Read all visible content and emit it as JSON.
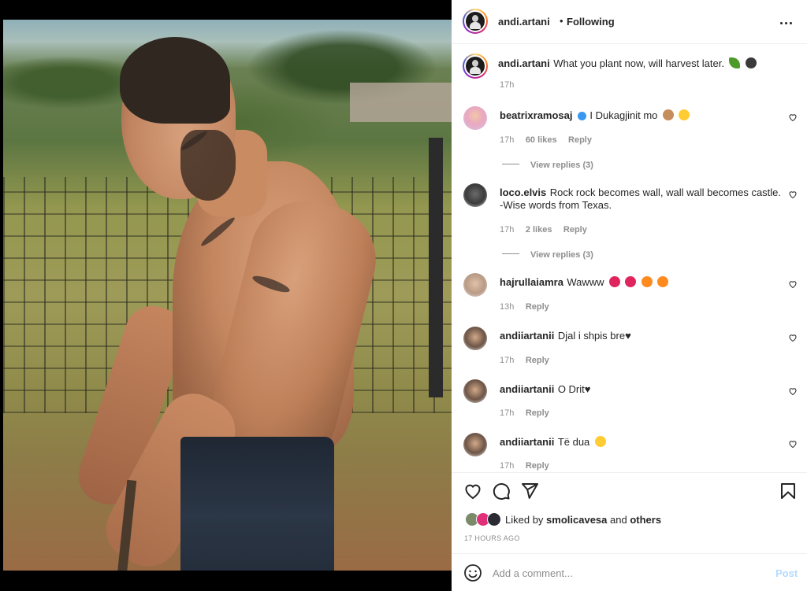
{
  "post": {
    "author": "andi.artani",
    "follow_status": "Following",
    "caption_text": "What you plant now, will harvest later.",
    "caption_time": "17h"
  },
  "comments": [
    {
      "user": "beatrixramosaj",
      "verified": true,
      "text": "I Dukagjinit mo",
      "time": "17h",
      "likes": "60 likes",
      "reply": "Reply",
      "view_replies": "View replies (3)"
    },
    {
      "user": "loco.elvis",
      "verified": false,
      "text": "Rock rock becomes wall, wall wall becomes castle.",
      "text2": "-Wise words from Texas.",
      "time": "17h",
      "likes": "2 likes",
      "reply": "Reply",
      "view_replies": "View replies (3)"
    },
    {
      "user": "hajrullaiamra",
      "verified": false,
      "text": "Wawww",
      "time": "13h",
      "reply": "Reply"
    },
    {
      "user": "andiiartanii",
      "verified": false,
      "text": "Djal i shpis bre",
      "time": "17h",
      "reply": "Reply"
    },
    {
      "user": "andiiartanii",
      "verified": false,
      "text": "O Drit",
      "time": "17h",
      "reply": "Reply"
    },
    {
      "user": "andiiartanii",
      "verified": false,
      "text": "Të dua",
      "time": "17h",
      "reply": "Reply"
    }
  ],
  "actions": {
    "liked_by_prefix": "Liked by",
    "liked_by_user": "smolicavesa",
    "liked_by_and": "and",
    "liked_by_others": "others",
    "timestamp": "17 HOURS AGO"
  },
  "composer": {
    "placeholder": "Add a comment...",
    "post_label": "Post"
  },
  "icons": {
    "more": "more-options-icon",
    "like": "heart-icon",
    "comment": "comment-icon",
    "share": "share-icon",
    "save": "bookmark-icon",
    "emoji": "emoji-icon"
  }
}
